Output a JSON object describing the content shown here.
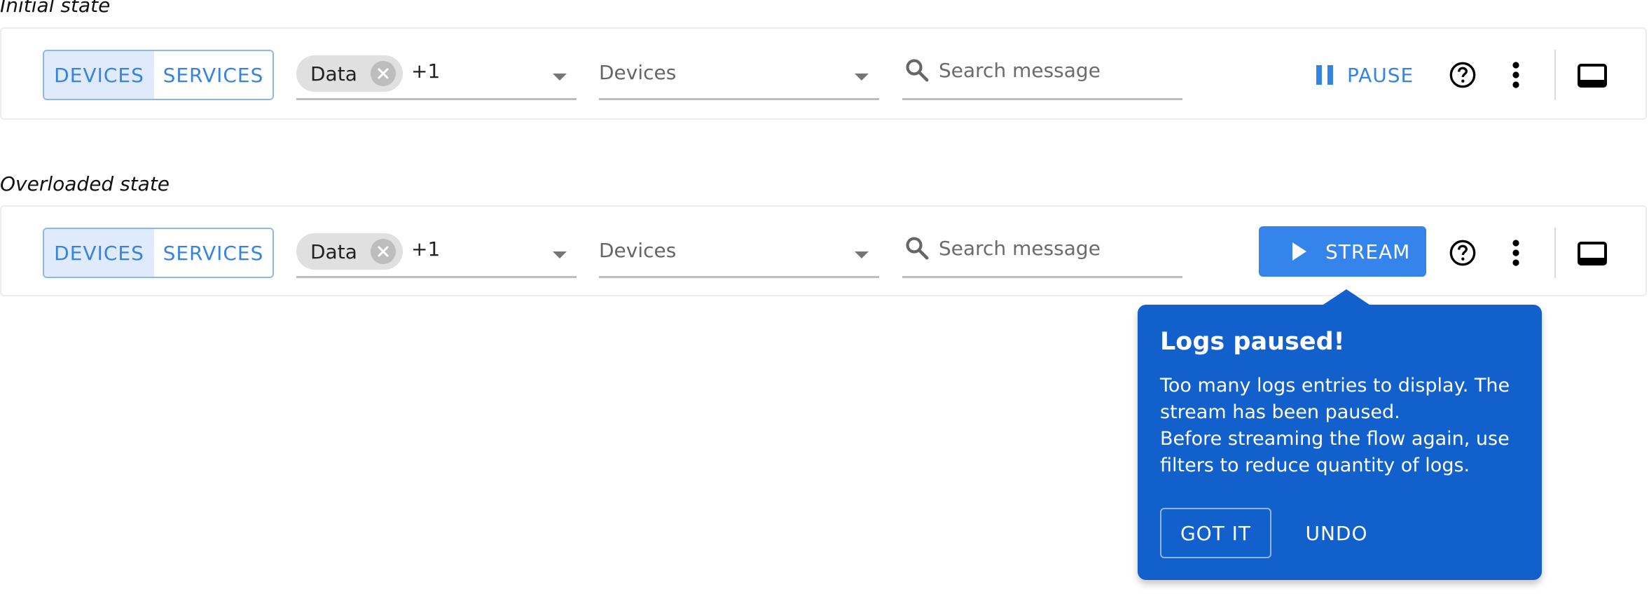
{
  "states": [
    {
      "label": "Initial state",
      "toolbar": {
        "toggle": {
          "active": "DEVICES",
          "inactive": "SERVICES"
        },
        "type_filter": {
          "chip_label": "Data",
          "extra_count": "+1"
        },
        "device_filter": {
          "value": "Devices"
        },
        "search": {
          "placeholder": "Search message",
          "value": ""
        },
        "stream_control": {
          "label": "PAUSE",
          "icon": "pause-icon"
        }
      }
    },
    {
      "label": "Overloaded state",
      "toolbar": {
        "toggle": {
          "active": "DEVICES",
          "inactive": "SERVICES"
        },
        "type_filter": {
          "chip_label": "Data",
          "extra_count": "+1"
        },
        "device_filter": {
          "value": "Devices"
        },
        "search": {
          "placeholder": "Search message",
          "value": ""
        },
        "stream_control": {
          "label": "STREAM",
          "icon": "play-icon"
        }
      }
    }
  ],
  "popover": {
    "title": "Logs paused!",
    "body_lines": [
      "Too many logs entries to display. The stream has been paused.",
      "Before streaming the flow again, use filters to reduce quantity of logs."
    ],
    "primary_action": "GOT IT",
    "secondary_action": "UNDO"
  },
  "icons": {
    "help": "help-circle-icon",
    "more": "more-vert-icon",
    "display": "bottom-panel-icon",
    "search": "search-icon",
    "chip_remove": "cancel-icon",
    "dropdown": "caret-down-icon"
  },
  "colors": {
    "accent": "#3584e4",
    "stream_button": "#3584eb",
    "popover_bg": "#1260cb",
    "toggle_active_bg": "#dfeafb",
    "toggle_border": "#8db6ef"
  }
}
